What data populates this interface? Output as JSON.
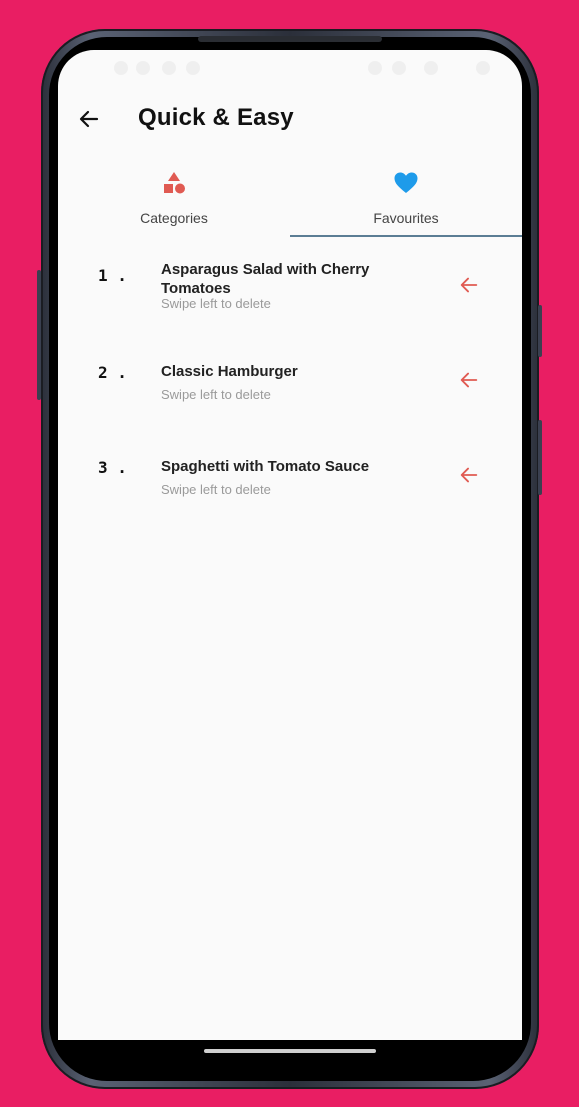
{
  "appbar": {
    "title": "Quick & Easy"
  },
  "tabs": [
    {
      "label": "Categories",
      "icon": "shapes-icon",
      "color": "#E05A52"
    },
    {
      "label": "Favourites",
      "icon": "heart-icon",
      "color": "#1E9BEA",
      "selected": true
    }
  ],
  "favourites": [
    {
      "index": "1 .",
      "name": "Asparagus Salad with Cherry Tomatoes",
      "hint": "Swipe left to delete"
    },
    {
      "index": "2 .",
      "name": "Classic Hamburger",
      "hint": "Swipe left to delete"
    },
    {
      "index": "3 .",
      "name": "Spaghetti with Tomato Sauce",
      "hint": "Swipe left to delete"
    }
  ],
  "colors": {
    "background": "#E91E63",
    "accent": "#E05A52",
    "favourite": "#1E9BEA",
    "indicator": "#5B7D94"
  }
}
